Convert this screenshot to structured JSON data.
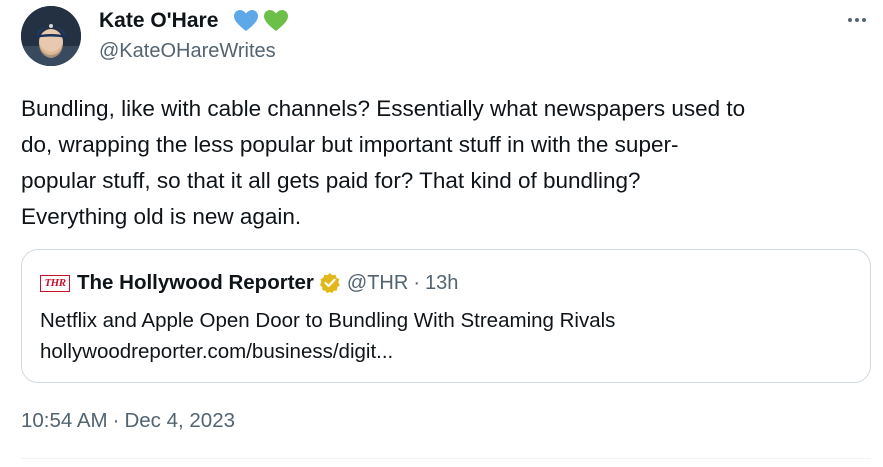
{
  "author": {
    "display_name": "Kate O'Hare",
    "handle": "@KateOHareWrites",
    "emoji_hearts": [
      "blue-heart",
      "green-heart"
    ]
  },
  "tweet": {
    "lines": [
      "Bundling, like with cable channels? Essentially what newspapers used to",
      "do, wrapping the less popular but important stuff in with the super-",
      "popular stuff, so that it all gets paid for? That kind of bundling?",
      "Everything old is new again."
    ]
  },
  "quote": {
    "logo_text": "THR",
    "name": "The Hollywood Reporter",
    "handle": "@THR",
    "separator": "·",
    "time": "13h",
    "title": "Netflix and Apple Open Door to Bundling With Streaming Rivals",
    "url": "hollywoodreporter.com/business/digit..."
  },
  "meta": {
    "time": "10:54 AM",
    "separator": "·",
    "date": "Dec 4, 2023"
  },
  "colors": {
    "text": "#0f1419",
    "secondary": "#536471",
    "border": "#cfd9de",
    "blue_heart": "#5fa8e8",
    "green_heart": "#6cc04a",
    "verified_gold": "#e2b719",
    "thr_red": "#c8102e"
  }
}
